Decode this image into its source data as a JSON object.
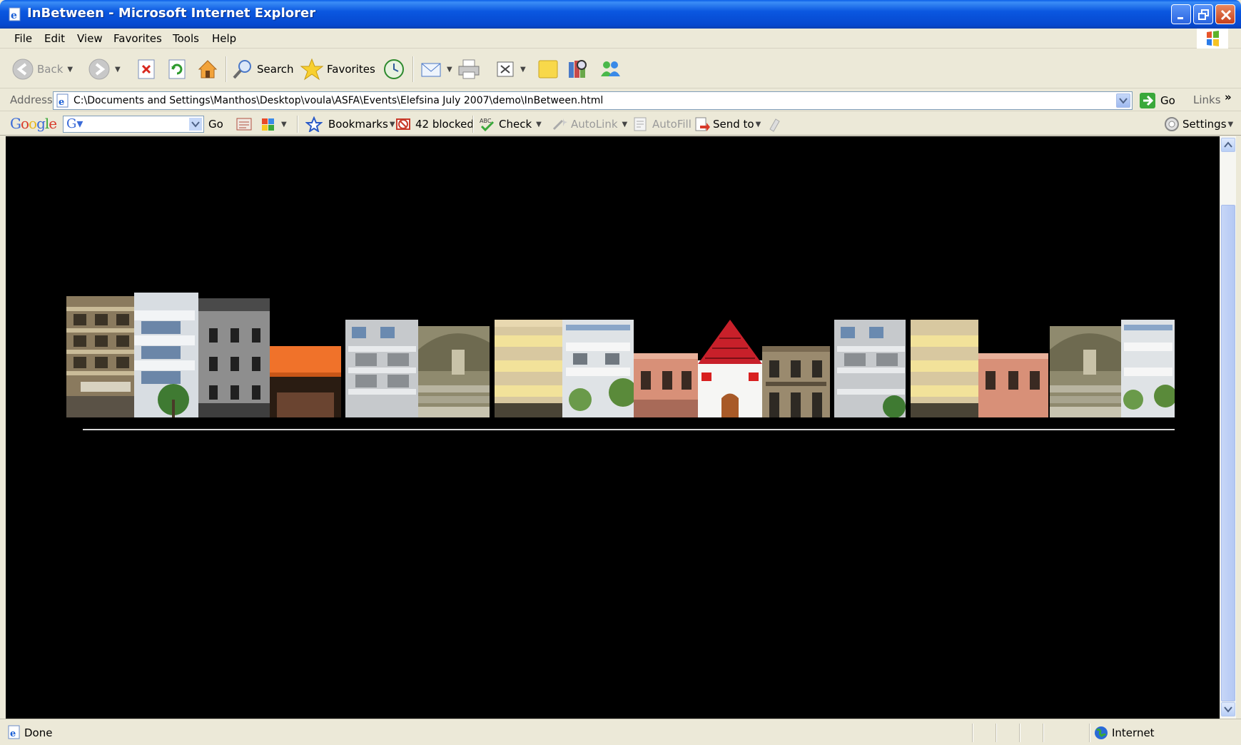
{
  "window": {
    "title": "InBetween - Microsoft Internet Explorer"
  },
  "menu": {
    "items": [
      "File",
      "Edit",
      "View",
      "Favorites",
      "Tools",
      "Help"
    ]
  },
  "toolbar": {
    "back_label": "Back",
    "search_label": "Search",
    "favorites_label": "Favorites"
  },
  "address": {
    "label": "Address",
    "url": "C:\\Documents and Settings\\Manthos\\Desktop\\voula\\ASFA\\Events\\Elefsina July 2007\\demo\\InBetween.html",
    "go_label": "Go",
    "links_label": "Links"
  },
  "google_toolbar": {
    "logo": "Google",
    "search_value": "",
    "go_label": "Go",
    "bookmarks_label": "Bookmarks",
    "blocked_label": "42 blocked",
    "check_label": "Check",
    "autolink_label": "AutoLink",
    "autofill_label": "AutoFill",
    "sendto_label": "Send to",
    "settings_label": "Settings"
  },
  "status": {
    "text": "Done",
    "zone": "Internet"
  },
  "colors": {
    "titlebar": "#0a57e0",
    "chrome": "#ece9d8",
    "content_bg": "#000000"
  }
}
